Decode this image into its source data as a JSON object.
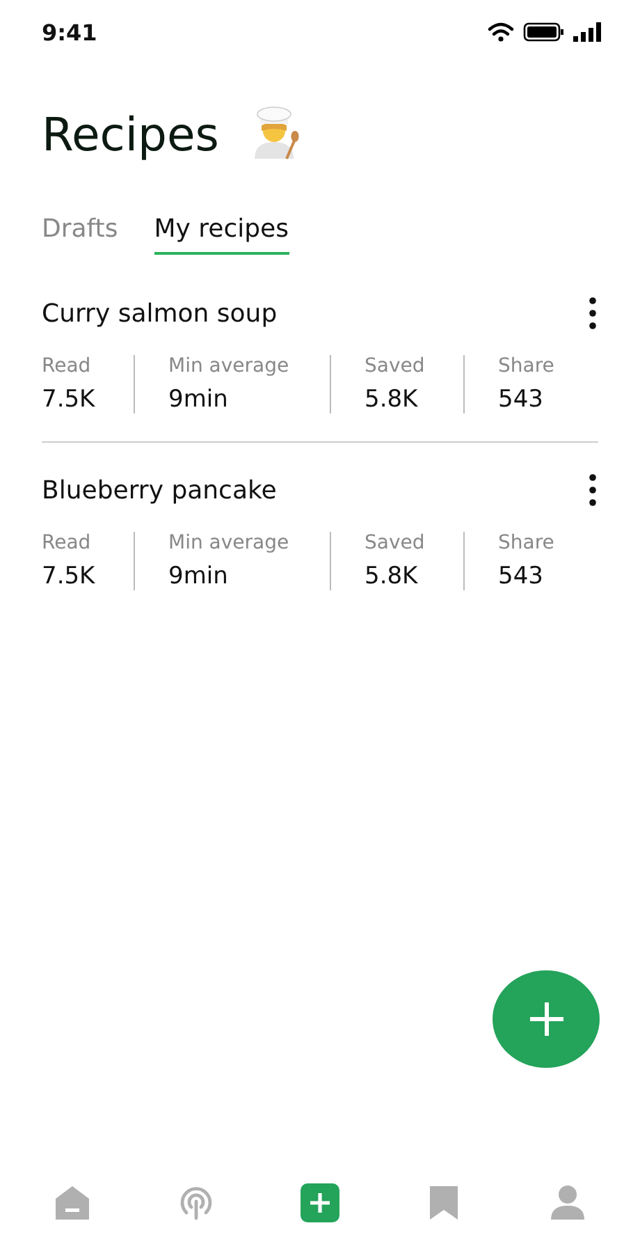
{
  "status_bar": {
    "time": "9:41"
  },
  "title": "Recipes",
  "tabs": [
    {
      "label": "Drafts",
      "selected": false
    },
    {
      "label": "My recipes",
      "selected": true
    }
  ],
  "recipes": [
    {
      "name": "Curry salmon soup",
      "stats": [
        {
          "label": "Read",
          "value": "7.5K"
        },
        {
          "label": "Min average",
          "value": "9min"
        },
        {
          "label": "Saved",
          "value": "5.8K"
        },
        {
          "label": "Share",
          "value": "543"
        }
      ]
    },
    {
      "name": "Blueberry pancake",
      "stats": [
        {
          "label": "Read",
          "value": "7.5K"
        },
        {
          "label": "Min average",
          "value": "9min"
        },
        {
          "label": "Saved",
          "value": "5.8K"
        },
        {
          "label": "Share",
          "value": "543"
        }
      ]
    }
  ],
  "nav": [
    {
      "kind": "home",
      "selected": false
    },
    {
      "kind": "broadcast",
      "selected": false
    },
    {
      "kind": "add",
      "selected": true
    },
    {
      "kind": "bookmark",
      "selected": false
    },
    {
      "kind": "profile",
      "selected": false
    }
  ]
}
